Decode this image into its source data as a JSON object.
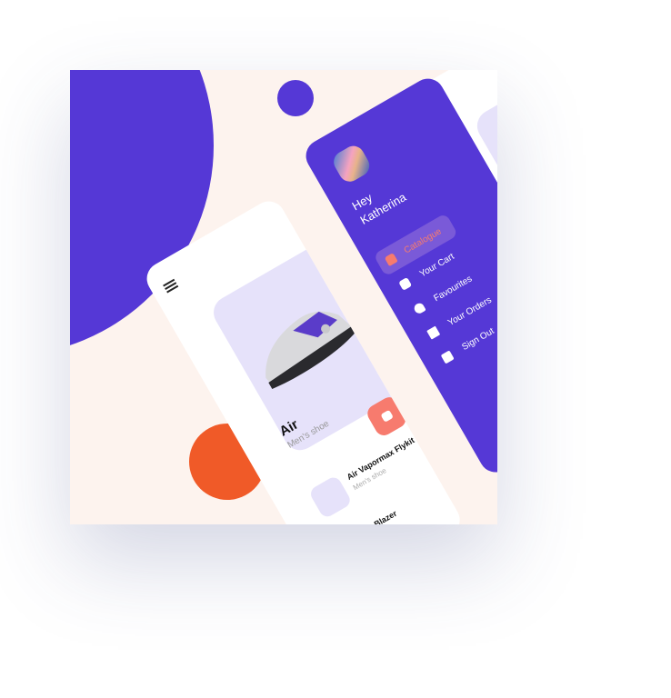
{
  "colors": {
    "accent": "#5538d6",
    "orange": "#f05a28",
    "coral": "#f77b6e",
    "lavender": "#e6e2fa",
    "bg": "#fdf3ee"
  },
  "menu": {
    "greeting": "Hey",
    "user_name": "Katherina",
    "items": [
      {
        "label": "Catalogue",
        "icon": "home-icon",
        "active": true
      },
      {
        "label": "Your Cart",
        "icon": "bag-icon"
      },
      {
        "label": "Favourites",
        "icon": "heart-icon"
      },
      {
        "label": "Your Orders",
        "icon": "clipboard-icon"
      },
      {
        "label": "Sign Out",
        "icon": "sign-out-icon"
      }
    ]
  },
  "catalogue": {
    "featured": {
      "title": "Air",
      "subtitle": "Men's shoe"
    },
    "list": [
      {
        "title": "Air Vapormax Flykit",
        "subtitle": "Men's shoe"
      },
      {
        "title": "Blazer",
        "subtitle": ""
      }
    ]
  }
}
